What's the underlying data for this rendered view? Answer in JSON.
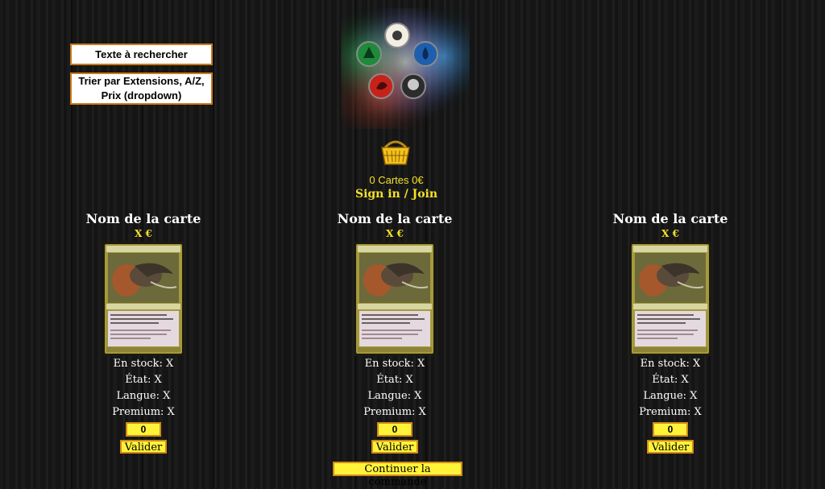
{
  "search": {
    "label": "Texte à rechercher"
  },
  "sort": {
    "label": "Trier par Extensions, A/Z, Prix (dropdown)"
  },
  "cart": {
    "summary": "0 Cartes 0€"
  },
  "auth": {
    "sign_in_label": "Sign in / Join"
  },
  "products": [
    {
      "name": "Nom de la carte",
      "price": "X €",
      "stock": "En stock: X",
      "etat": "État: X",
      "langue": "Langue: X",
      "premium": "Premium: X",
      "quantity": "0",
      "validate_label": "Valider"
    },
    {
      "name": "Nom de la carte",
      "price": "X €",
      "stock": "En stock: X",
      "etat": "État: X",
      "langue": "Langue: X",
      "premium": "Premium: X",
      "quantity": "0",
      "validate_label": "Valider"
    },
    {
      "name": "Nom de la carte",
      "price": "X €",
      "stock": "En stock: X",
      "etat": "État: X",
      "langue": "Langue: X",
      "premium": "Premium: X",
      "quantity": "0",
      "validate_label": "Valider"
    }
  ],
  "checkout": {
    "continue_label": "Continuer la commande"
  },
  "icons": {
    "logo": "mana-wheel-logo",
    "basket": "shopping-basket-icon",
    "card": "card-image"
  },
  "colors": {
    "accent_yellow": "#fff33a",
    "accent_border": "#d28b1a",
    "text_yellow": "#f3e12a",
    "box_border": "#c97a1c"
  }
}
